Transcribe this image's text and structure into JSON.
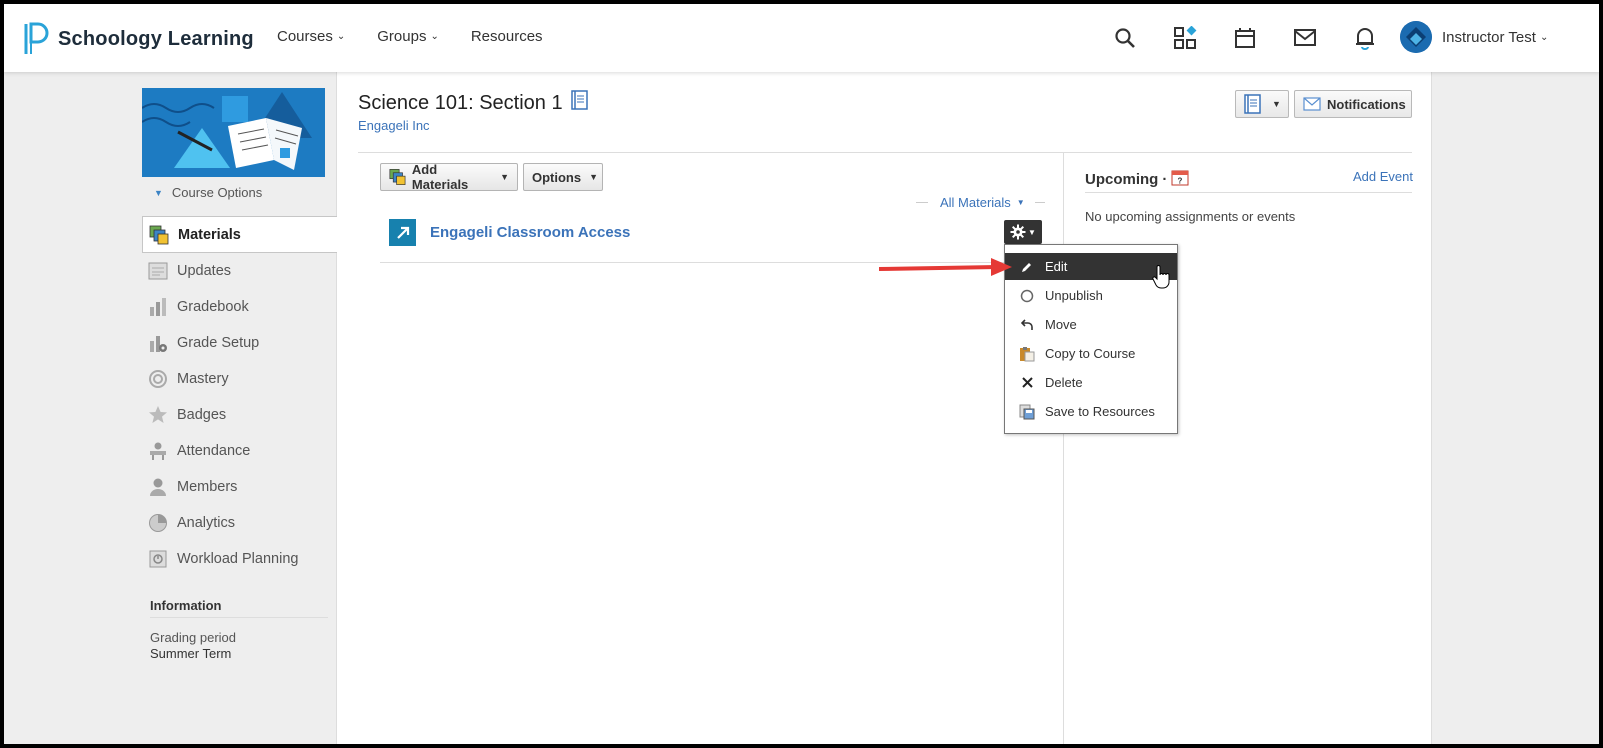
{
  "app": {
    "name": "Schoology Learning"
  },
  "nav": {
    "links": [
      {
        "label": "Courses",
        "has_menu": true
      },
      {
        "label": "Groups",
        "has_menu": true
      },
      {
        "label": "Resources",
        "has_menu": false
      }
    ],
    "icons": [
      "search-icon",
      "apps-grid-icon",
      "calendar-icon",
      "mail-icon",
      "bell-icon"
    ],
    "user_name": "Instructor Test"
  },
  "sidebar": {
    "course_options": "Course Options",
    "items": [
      {
        "label": "Materials",
        "icon": "materials-icon",
        "active": true
      },
      {
        "label": "Updates",
        "icon": "updates-icon",
        "active": false
      },
      {
        "label": "Gradebook",
        "icon": "gradebook-icon",
        "active": false
      },
      {
        "label": "Grade Setup",
        "icon": "grade-setup-icon",
        "active": false
      },
      {
        "label": "Mastery",
        "icon": "mastery-icon",
        "active": false
      },
      {
        "label": "Badges",
        "icon": "badge-icon",
        "active": false
      },
      {
        "label": "Attendance",
        "icon": "attendance-icon",
        "active": false
      },
      {
        "label": "Members",
        "icon": "members-icon",
        "active": false
      },
      {
        "label": "Analytics",
        "icon": "analytics-icon",
        "active": false
      },
      {
        "label": "Workload Planning",
        "icon": "workload-icon",
        "active": false
      }
    ],
    "info": {
      "title": "Information",
      "grading_label": "Grading period",
      "grading_value": "Summer Term"
    }
  },
  "course": {
    "title": "Science 101: Section 1",
    "org": "Engageli Inc"
  },
  "header_buttons": {
    "notifications": "Notifications"
  },
  "toolbar": {
    "add_materials": "Add Materials",
    "options": "Options",
    "filter": "All Materials"
  },
  "materials": [
    {
      "title": "Engageli Classroom Access",
      "icon": "external-link-icon"
    }
  ],
  "action_menu": {
    "items": [
      {
        "label": "Edit",
        "icon": "pencil-icon",
        "selected": true
      },
      {
        "label": "Unpublish",
        "icon": "circle-icon",
        "selected": false
      },
      {
        "label": "Move",
        "icon": "move-arrow-icon",
        "selected": false
      },
      {
        "label": "Copy to Course",
        "icon": "clipboard-icon",
        "selected": false
      },
      {
        "label": "Delete",
        "icon": "x-icon",
        "selected": false
      },
      {
        "label": "Save to Resources",
        "icon": "save-resources-icon",
        "selected": false
      }
    ]
  },
  "upcoming": {
    "title": "Upcoming",
    "add_event": "Add Event",
    "empty": "No upcoming assignments or events"
  },
  "colors": {
    "link": "#3b73b9",
    "brand_blue": "#1d7bc2",
    "menu_selected": "#333333",
    "annotation_arrow": "#e53935"
  }
}
